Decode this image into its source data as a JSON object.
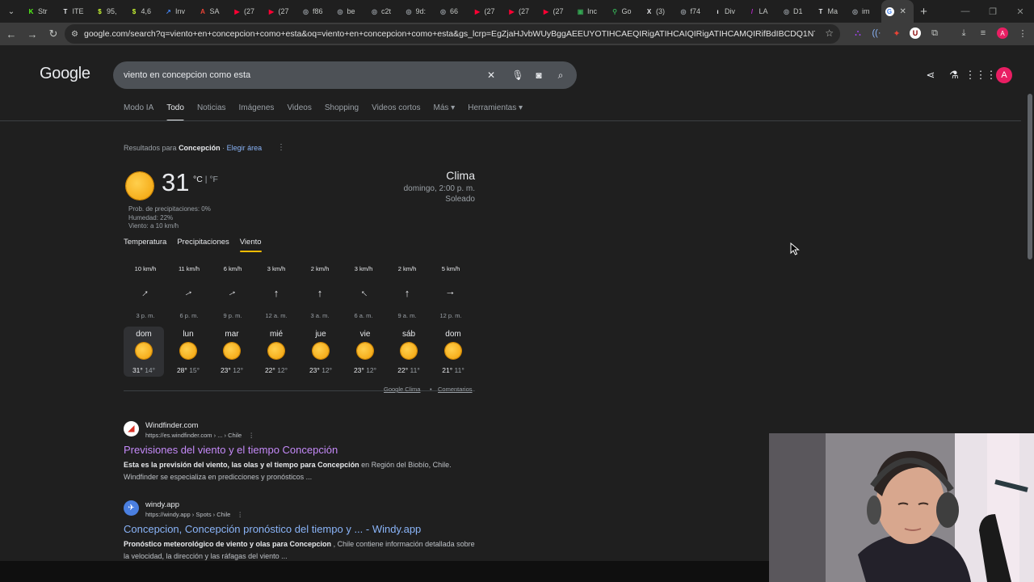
{
  "browser": {
    "tabs": [
      {
        "label": "Str",
        "icon": "k-icon",
        "color": "#53fc18",
        "glyph": "K"
      },
      {
        "label": "ITE",
        "icon": "itemhub-icon",
        "color": "#e8eaed",
        "glyph": "T"
      },
      {
        "label": "95,",
        "icon": "chart-icon",
        "color": "#c6f432",
        "glyph": "$"
      },
      {
        "label": "4,6",
        "icon": "chart-icon",
        "color": "#c6f432",
        "glyph": "$"
      },
      {
        "label": "Inv",
        "icon": "invest-icon",
        "color": "#4285f4",
        "glyph": "↗"
      },
      {
        "label": "SA",
        "icon": "sa-icon",
        "color": "#ea4335",
        "glyph": "A"
      },
      {
        "label": "(27",
        "icon": "youtube-icon",
        "color": "#ff0033",
        "glyph": "▶"
      },
      {
        "label": "(27",
        "icon": "youtube-icon",
        "color": "#ff0033",
        "glyph": "▶"
      },
      {
        "label": "f86",
        "icon": "globe-icon",
        "color": "#9aa0a6",
        "glyph": "◎"
      },
      {
        "label": "be",
        "icon": "globe-icon",
        "color": "#9aa0a6",
        "glyph": "◎"
      },
      {
        "label": "c2t",
        "icon": "globe-icon",
        "color": "#9aa0a6",
        "glyph": "◎"
      },
      {
        "label": "9d:",
        "icon": "globe-icon",
        "color": "#9aa0a6",
        "glyph": "◎"
      },
      {
        "label": "66",
        "icon": "globe-icon",
        "color": "#9aa0a6",
        "glyph": "◎"
      },
      {
        "label": "(27",
        "icon": "youtube-icon",
        "color": "#ff0033",
        "glyph": "▶"
      },
      {
        "label": "(27",
        "icon": "youtube-icon",
        "color": "#ff0033",
        "glyph": "▶"
      },
      {
        "label": "(27",
        "icon": "youtube-icon",
        "color": "#ff0033",
        "glyph": "▶"
      },
      {
        "label": "Inc",
        "icon": "inc-icon",
        "color": "#34a853",
        "glyph": "▣"
      },
      {
        "label": "Go",
        "icon": "maps-icon",
        "color": "#34a853",
        "glyph": "⚲"
      },
      {
        "label": "(3)",
        "icon": "x-icon",
        "color": "#e8eaed",
        "glyph": "X"
      },
      {
        "label": "f74",
        "icon": "globe-icon",
        "color": "#9aa0a6",
        "glyph": "◎"
      },
      {
        "label": "Div",
        "icon": "investing-icon",
        "color": "#e8eaed",
        "glyph": "ı"
      },
      {
        "label": "LA",
        "icon": "la-icon",
        "color": "#c026d3",
        "glyph": "/"
      },
      {
        "label": "D1",
        "icon": "globe-icon",
        "color": "#9aa0a6",
        "glyph": "◎"
      },
      {
        "label": "Ma",
        "icon": "tv-icon",
        "color": "#e8eaed",
        "glyph": "T"
      },
      {
        "label": "im",
        "icon": "globe-icon",
        "color": "#9aa0a6",
        "glyph": "◎"
      }
    ],
    "url": "google.com/search?q=viento+en+concepcion+como+esta&oq=viento+en+concepcion+como+esta&gs_lcrp=EgZjaHJvbWUyBggAEEUYOTIHCAEQIRigATIHCAIQIRigATIHCAMQIRifBdIBCDQ1NTNqMGo3qAIAsAIA&sourc...",
    "profile_initial": "A"
  },
  "google": {
    "logo": "Google",
    "query": "viento en concepcion como esta",
    "tabs": [
      "Modo IA",
      "Todo",
      "Noticias",
      "Imágenes",
      "Videos",
      "Shopping",
      "Videos cortos",
      "Más ▾",
      "Herramientas ▾"
    ],
    "active_tab": "Todo",
    "account_initial": "A"
  },
  "weather": {
    "results_for_prefix": "Resultados para",
    "location": "Concepción",
    "choose_area": "Elegir área",
    "temperature": "31",
    "unit_c": "°C",
    "unit_sep": " | ",
    "unit_f": "°F",
    "precip": "Prob. de precipitaciones: 0%",
    "humidity": "Humedad: 22%",
    "wind": "Viento: a 10 km/h",
    "title": "Clima",
    "datetime": "domingo, 2:00 p. m.",
    "condition": "Soleado",
    "tabs": [
      "Temperatura",
      "Precipitaciones",
      "Viento"
    ],
    "active_tab": "Viento",
    "wind_hours": [
      {
        "speed": "10 km/h",
        "time": "3 p. m.",
        "direction_deg": 45
      },
      {
        "speed": "11 km/h",
        "time": "6 p. m.",
        "direction_deg": 60
      },
      {
        "speed": "6 km/h",
        "time": "9 p. m.",
        "direction_deg": 60
      },
      {
        "speed": "3 km/h",
        "time": "12 a. m.",
        "direction_deg": 0
      },
      {
        "speed": "2 km/h",
        "time": "3 a. m.",
        "direction_deg": 0
      },
      {
        "speed": "3 km/h",
        "time": "6 a. m.",
        "direction_deg": -45
      },
      {
        "speed": "2 km/h",
        "time": "9 a. m.",
        "direction_deg": 0
      },
      {
        "speed": "5 km/h",
        "time": "12 p. m.",
        "direction_deg": 90
      }
    ],
    "days": [
      {
        "name": "dom",
        "high": "31°",
        "low": "14°"
      },
      {
        "name": "lun",
        "high": "28°",
        "low": "15°"
      },
      {
        "name": "mar",
        "high": "23°",
        "low": "12°"
      },
      {
        "name": "mié",
        "high": "22°",
        "low": "12°"
      },
      {
        "name": "jue",
        "high": "23°",
        "low": "12°"
      },
      {
        "name": "vie",
        "high": "23°",
        "low": "12°"
      },
      {
        "name": "sáb",
        "high": "22°",
        "low": "11°"
      },
      {
        "name": "dom",
        "high": "21°",
        "low": "11°"
      }
    ],
    "footer_source": "Google Clima",
    "footer_sep": "•",
    "footer_feedback": "Comentarios"
  },
  "results": [
    {
      "site": "Windfinder.com",
      "url": "https://es.windfinder.com › ... › Chile",
      "title": "Previsiones del viento y el tiempo Concepción",
      "visited": true,
      "snippet_bold_1": "Esta es la previsión del viento, las olas y el tiempo para Concepción",
      "snippet_rest_1": " en Región del Biobío, Chile. Windfinder se especializa en predicciones y pronósticos ...",
      "favicon_color": "#ffffff"
    },
    {
      "site": "windy.app",
      "url": "https://windy.app › Spots › Chile",
      "title": "Concepcion, Concepción pronóstico del tiempo y ... - Windy.app",
      "visited": false,
      "snippet_bold_1": "Pronóstico meteorológico de viento y olas para Concepcion",
      "snippet_rest_1": " , Chile contiene información detallada sobre la velocidad, la dirección y las ráfagas del viento ...",
      "favicon_color": "#4a7fe0"
    }
  ]
}
